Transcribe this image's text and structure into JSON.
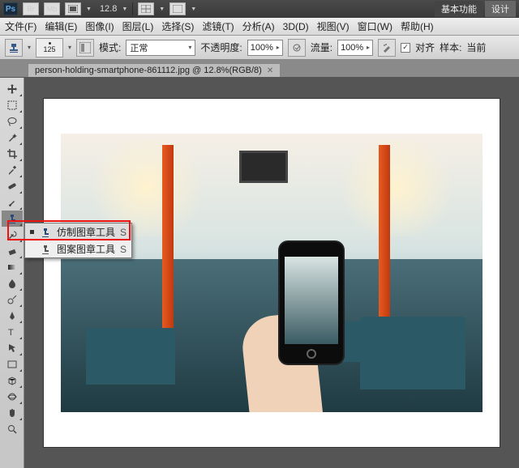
{
  "titlebar": {
    "app": "Ps",
    "btn_br": "Br",
    "btn_mb": "Mb",
    "zoom": "12.8",
    "workspace_primary": "基本功能",
    "workspace_secondary": "设计"
  },
  "menu": {
    "file": "文件(F)",
    "edit": "编辑(E)",
    "image": "图像(I)",
    "layer": "图层(L)",
    "select": "选择(S)",
    "filter": "滤镜(T)",
    "analysis": "分析(A)",
    "threed": "3D(D)",
    "view": "视图(V)",
    "window": "窗口(W)",
    "help": "帮助(H)"
  },
  "options": {
    "brush_size": "125",
    "mode_label": "模式:",
    "mode_value": "正常",
    "opacity_label": "不透明度:",
    "opacity_value": "100%",
    "flow_label": "流量:",
    "flow_value": "100%",
    "aligned_label": "对齐",
    "sample_label": "样本:",
    "sample_value": "当前"
  },
  "tab": {
    "title": "person-holding-smartphone-861112.jpg @ 12.8%(RGB/8)"
  },
  "flyout": {
    "items": [
      {
        "label": "仿制图章工具",
        "shortcut": "S"
      },
      {
        "label": "图案图章工具",
        "shortcut": "S"
      }
    ]
  },
  "tools": [
    "move",
    "marquee",
    "lasso",
    "wand",
    "crop",
    "eyedropper",
    "heal",
    "brush",
    "stamp",
    "history",
    "eraser",
    "gradient",
    "blur",
    "dodge",
    "pen",
    "type",
    "path-select",
    "rect",
    "hand",
    "zoom",
    "swap",
    "fg-bg",
    "quickmask",
    "screen-mode"
  ]
}
